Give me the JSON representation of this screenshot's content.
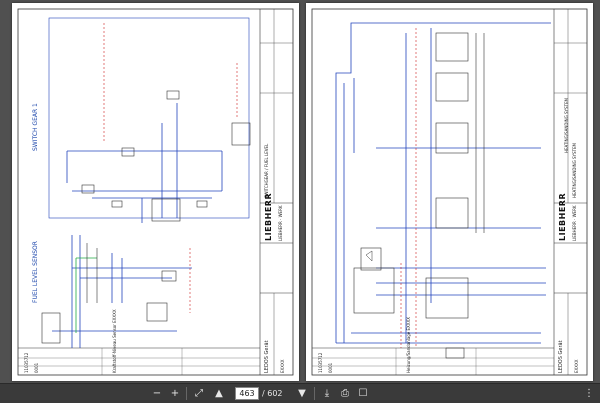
{
  "toolbar": {
    "current_page": "463",
    "total_pages": "/ 602",
    "icons": [
      "zoom-out-icon",
      "zoom-in-icon",
      "fit-page-icon",
      "prev-page-icon",
      "next-page-icon",
      "download-icon",
      "print-icon",
      "bookmark-icon",
      "more-icon"
    ]
  },
  "left_page": {
    "section_title": "SWITCH GEAR 1",
    "sensor_title": "FUEL LEVEL SENSOR",
    "brand": "LIEBHERR",
    "brand_sub": "LIEBHERR · WERK",
    "title_block": {
      "doc_title": "LEDOS Gerät",
      "code1": "11035712",
      "code2": "0001",
      "project": "Kraftstoff-Niveau Sensor EXXXX",
      "designation": "SWITCHGEAR / FUEL LEVEL",
      "unit": "EXXXX"
    }
  },
  "right_page": {
    "section_title": "HEATING/SANDING SYSTEM",
    "brand": "LIEBHERR",
    "brand_sub": "LIEBHERR · WERK",
    "title_block": {
      "doc_title": "LEDOS Gerät",
      "code1": "11035712",
      "code2": "0001",
      "project": "Heizung/Sandanlage EXXXX",
      "designation": "HEATING/SANDING SYSTEM",
      "unit": "EXXXX"
    }
  },
  "colors": {
    "wire_blue": "#2244bb",
    "wire_red": "#cc2222",
    "wire_green": "#22aa44",
    "frame": "#333333"
  }
}
